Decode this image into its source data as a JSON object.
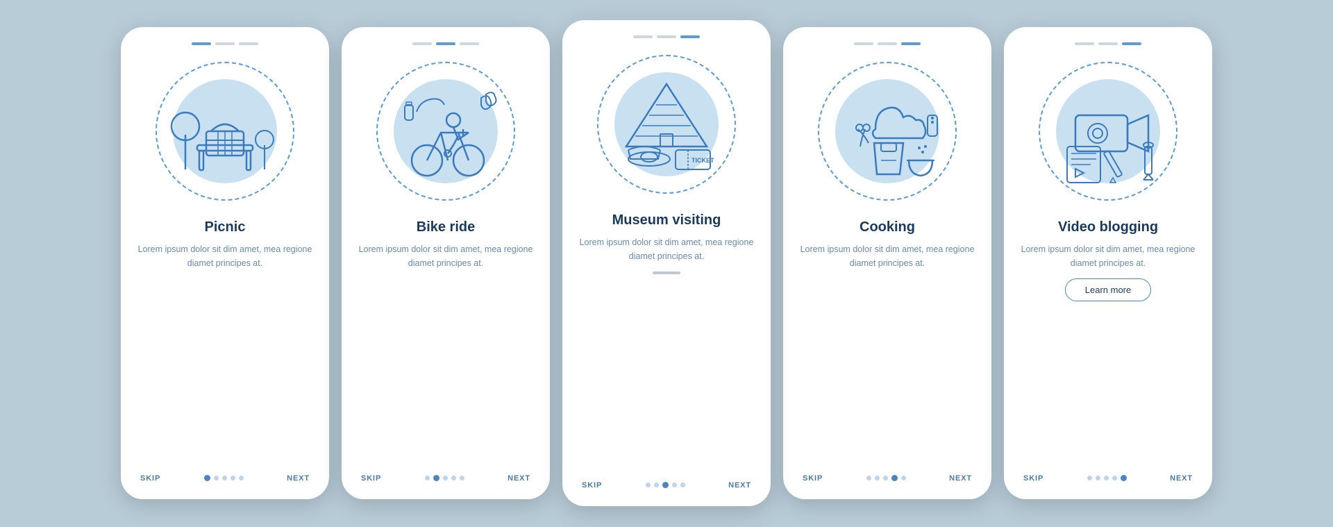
{
  "screens": [
    {
      "id": "picnic",
      "title": "Picnic",
      "body": "Lorem ipsum dolor sit dim amet, mea regione diamet principes at.",
      "skip_label": "SKIP",
      "next_label": "NEXT",
      "active_dot": 0,
      "dot_count": 5,
      "has_learn_more": false,
      "top_active": 0,
      "scroll_bar": false
    },
    {
      "id": "bike-ride",
      "title": "Bike ride",
      "body": "Lorem ipsum dolor sit dim amet, mea regione diamet principes at.",
      "skip_label": "SKIP",
      "next_label": "NEXT",
      "active_dot": 1,
      "dot_count": 5,
      "has_learn_more": false,
      "top_active": 1,
      "scroll_bar": false
    },
    {
      "id": "museum-visiting",
      "title": "Museum visiting",
      "body": "Lorem ipsum dolor sit dim amet, mea regione diamet principes at.",
      "skip_label": "SKIP",
      "next_label": "NEXT",
      "active_dot": 2,
      "dot_count": 5,
      "has_learn_more": false,
      "top_active": 2,
      "scroll_bar": true
    },
    {
      "id": "cooking",
      "title": "Cooking",
      "body": "Lorem ipsum dolor sit dim amet, mea regione diamet principes at.",
      "skip_label": "SKIP",
      "next_label": "NEXT",
      "active_dot": 3,
      "dot_count": 5,
      "has_learn_more": false,
      "top_active": 3,
      "scroll_bar": false
    },
    {
      "id": "video-blogging",
      "title": "Video blogging",
      "body": "Lorem ipsum dolor sit dim amet, mea regione diamet principes at.",
      "skip_label": "SKIP",
      "next_label": "NEXT",
      "active_dot": 4,
      "dot_count": 5,
      "has_learn_more": true,
      "learn_more_label": "Learn more",
      "top_active": 4,
      "scroll_bar": false
    }
  ]
}
